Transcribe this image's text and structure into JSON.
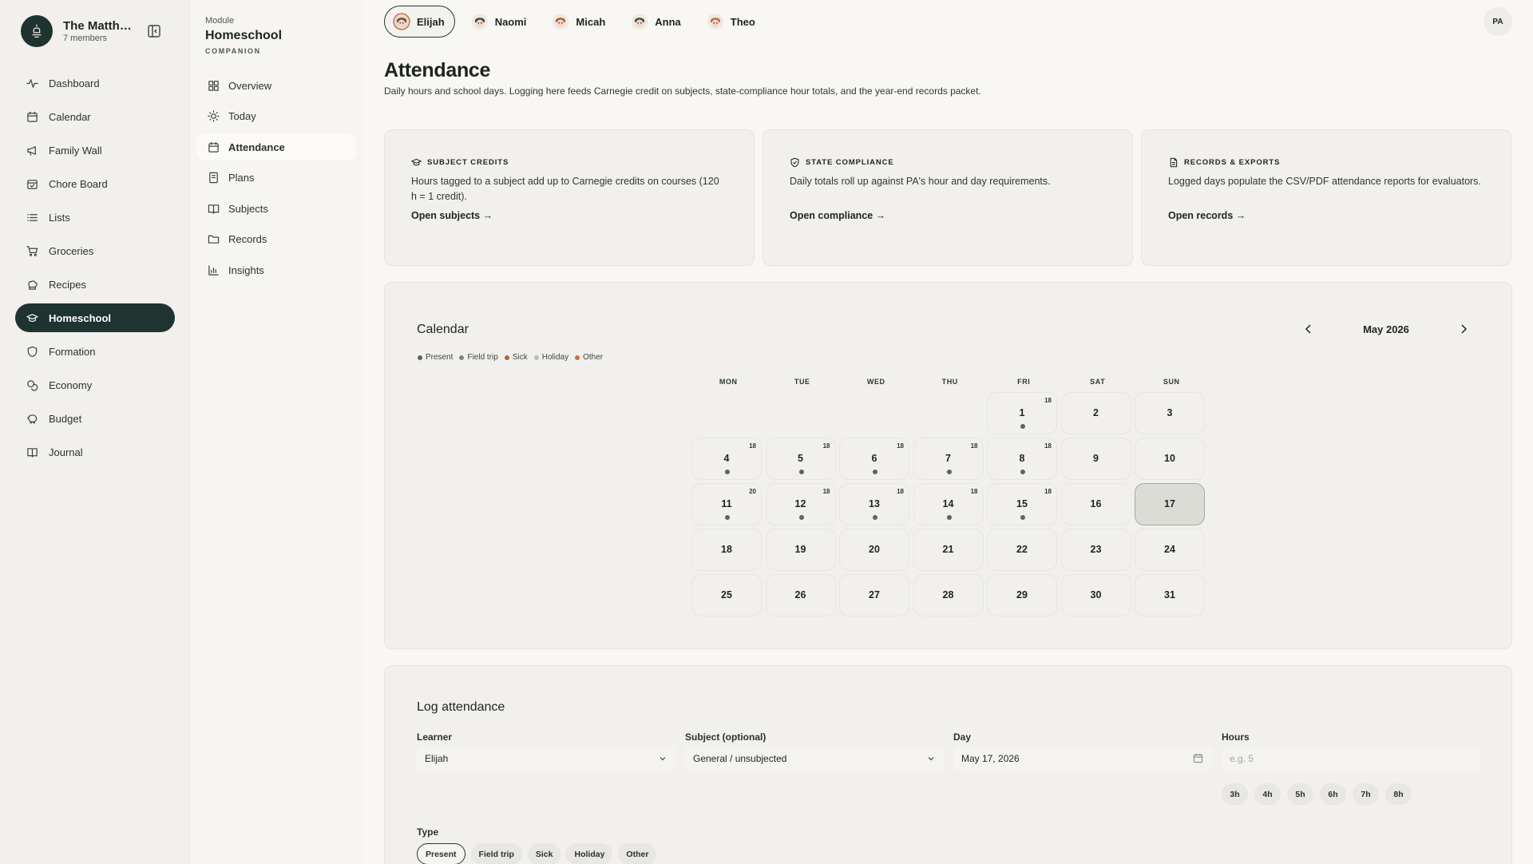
{
  "app": {
    "family_name": "The Matthe...",
    "members": "7 members",
    "user_initials": "PA"
  },
  "nav": [
    {
      "label": "Dashboard",
      "icon": "activity-icon"
    },
    {
      "label": "Calendar",
      "icon": "calendar-icon"
    },
    {
      "label": "Family Wall",
      "icon": "megaphone-icon"
    },
    {
      "label": "Chore Board",
      "icon": "calendar-check-icon"
    },
    {
      "label": "Lists",
      "icon": "list-icon"
    },
    {
      "label": "Groceries",
      "icon": "cart-icon"
    },
    {
      "label": "Recipes",
      "icon": "chef-hat-icon"
    },
    {
      "label": "Homeschool",
      "icon": "graduation-cap-icon",
      "active": true
    },
    {
      "label": "Formation",
      "icon": "shield-icon"
    },
    {
      "label": "Economy",
      "icon": "coins-icon"
    },
    {
      "label": "Budget",
      "icon": "piggy-bank-icon"
    },
    {
      "label": "Journal",
      "icon": "book-icon"
    }
  ],
  "module": {
    "label": "Module",
    "title": "Homeschool",
    "subtitle": "COMPANION",
    "items": [
      {
        "label": "Overview",
        "icon": "grid-icon"
      },
      {
        "label": "Today",
        "icon": "sun-icon"
      },
      {
        "label": "Attendance",
        "icon": "calendar-icon",
        "active": true
      },
      {
        "label": "Plans",
        "icon": "notebook-icon"
      },
      {
        "label": "Subjects",
        "icon": "book-open-icon"
      },
      {
        "label": "Records",
        "icon": "folder-icon"
      },
      {
        "label": "Insights",
        "icon": "bar-chart-icon"
      }
    ]
  },
  "learners": [
    {
      "name": "Elijah",
      "active": true,
      "avatar_color": "#6b4a3a"
    },
    {
      "name": "Naomi",
      "active": false,
      "avatar_color": "#3d4745"
    },
    {
      "name": "Micah",
      "active": false,
      "avatar_color": "#b0563a"
    },
    {
      "name": "Anna",
      "active": false,
      "avatar_color": "#454d4b"
    },
    {
      "name": "Theo",
      "active": false,
      "avatar_color": "#c46a3e"
    }
  ],
  "page": {
    "title": "Attendance",
    "subtitle": "Daily hours and school days. Logging here feeds Carnegie credit on subjects, state-compliance hour totals, and the year-end records packet."
  },
  "cards": [
    {
      "heading": "SUBJECT CREDITS",
      "icon": "graduation-cap-icon",
      "body": "Hours tagged to a subject add up to Carnegie credits on courses (120 h = 1 credit).",
      "link": "Open subjects →"
    },
    {
      "heading": "STATE COMPLIANCE",
      "icon": "shield-check-icon",
      "body": "Daily totals roll up against PA's hour and day requirements.",
      "link": "Open compliance →"
    },
    {
      "heading": "RECORDS & EXPORTS",
      "icon": "file-icon",
      "body": "Logged days populate the CSV/PDF attendance reports for evaluators.",
      "link": "Open records →"
    }
  ],
  "calendar": {
    "title": "Calendar",
    "month": "May 2026",
    "legend": [
      {
        "label": "Present",
        "color": "#5b6461"
      },
      {
        "label": "Field trip",
        "color": "#7a8380"
      },
      {
        "label": "Sick",
        "color": "#b5612f"
      },
      {
        "label": "Holiday",
        "color": "#b9bcb8"
      },
      {
        "label": "Other",
        "color": "#c4743a"
      }
    ],
    "weekdays": [
      "MON",
      "TUE",
      "WED",
      "THU",
      "FRI",
      "SAT",
      "SUN"
    ],
    "first_weekday_index": 4,
    "today": 17,
    "days": [
      {
        "d": "1",
        "h": "18",
        "dot": true
      },
      {
        "d": "2"
      },
      {
        "d": "3"
      },
      {
        "d": "4",
        "h": "18",
        "dot": true
      },
      {
        "d": "5",
        "h": "18",
        "dot": true
      },
      {
        "d": "6",
        "h": "18",
        "dot": true
      },
      {
        "d": "7",
        "h": "18",
        "dot": true
      },
      {
        "d": "8",
        "h": "18",
        "dot": true
      },
      {
        "d": "9"
      },
      {
        "d": "10"
      },
      {
        "d": "11",
        "h": "20",
        "dot": true
      },
      {
        "d": "12",
        "h": "18",
        "dot": true
      },
      {
        "d": "13",
        "h": "18",
        "dot": true
      },
      {
        "d": "14",
        "h": "18",
        "dot": true
      },
      {
        "d": "15",
        "h": "18",
        "dot": true
      },
      {
        "d": "16"
      },
      {
        "d": "17"
      },
      {
        "d": "18"
      },
      {
        "d": "19"
      },
      {
        "d": "20"
      },
      {
        "d": "21"
      },
      {
        "d": "22"
      },
      {
        "d": "23"
      },
      {
        "d": "24"
      },
      {
        "d": "25"
      },
      {
        "d": "26"
      },
      {
        "d": "27"
      },
      {
        "d": "28"
      },
      {
        "d": "29"
      },
      {
        "d": "30"
      },
      {
        "d": "31"
      }
    ]
  },
  "log": {
    "title": "Log attendance",
    "learner_label": "Learner",
    "learner_value": "Elijah",
    "subject_label": "Subject (optional)",
    "subject_value": "General / unsubjected",
    "day_label": "Day",
    "day_value": "May 17, 2026",
    "hours_label": "Hours",
    "hours_placeholder": "e.g. 5",
    "hour_chips": [
      "3h",
      "4h",
      "5h",
      "6h",
      "7h",
      "8h"
    ],
    "type_label": "Type",
    "types": [
      {
        "label": "Present",
        "active": true
      },
      {
        "label": "Field trip"
      },
      {
        "label": "Sick"
      },
      {
        "label": "Holiday"
      },
      {
        "label": "Other"
      }
    ]
  }
}
